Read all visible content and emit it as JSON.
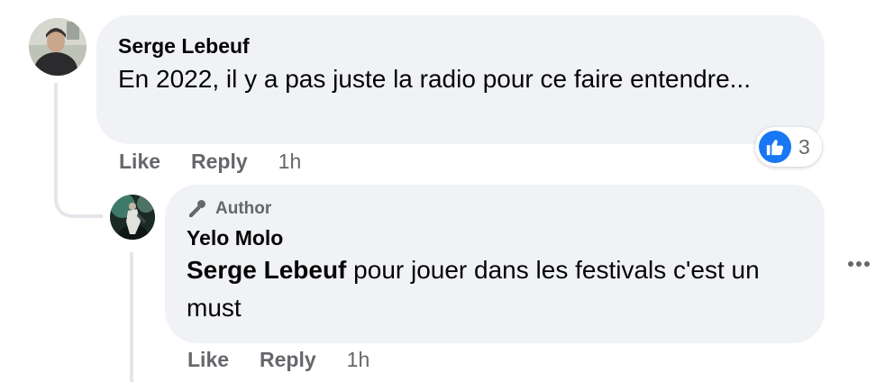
{
  "comments": [
    {
      "author": "Serge Lebeuf",
      "text": "En 2022, il y a pas juste la radio pour ce faire entendre...",
      "actions": {
        "like": "Like",
        "reply": "Reply",
        "time": "1h"
      },
      "reactions": {
        "icon": "like-icon",
        "count": "3"
      }
    }
  ],
  "replies": [
    {
      "badge": "Author",
      "badge_icon": "microphone-icon",
      "author": "Yelo Molo",
      "mention": "Serge Lebeuf",
      "text": " pour jouer dans les festivals c'est un must",
      "actions": {
        "like": "Like",
        "reply": "Reply",
        "time": "1h"
      },
      "more_icon": "more-options-icon"
    }
  ],
  "colors": {
    "bubble_bg": "#f0f2f5",
    "secondary_text": "#65676b",
    "like_blue": "#1877f2",
    "thread_line": "#e4e6eb"
  }
}
